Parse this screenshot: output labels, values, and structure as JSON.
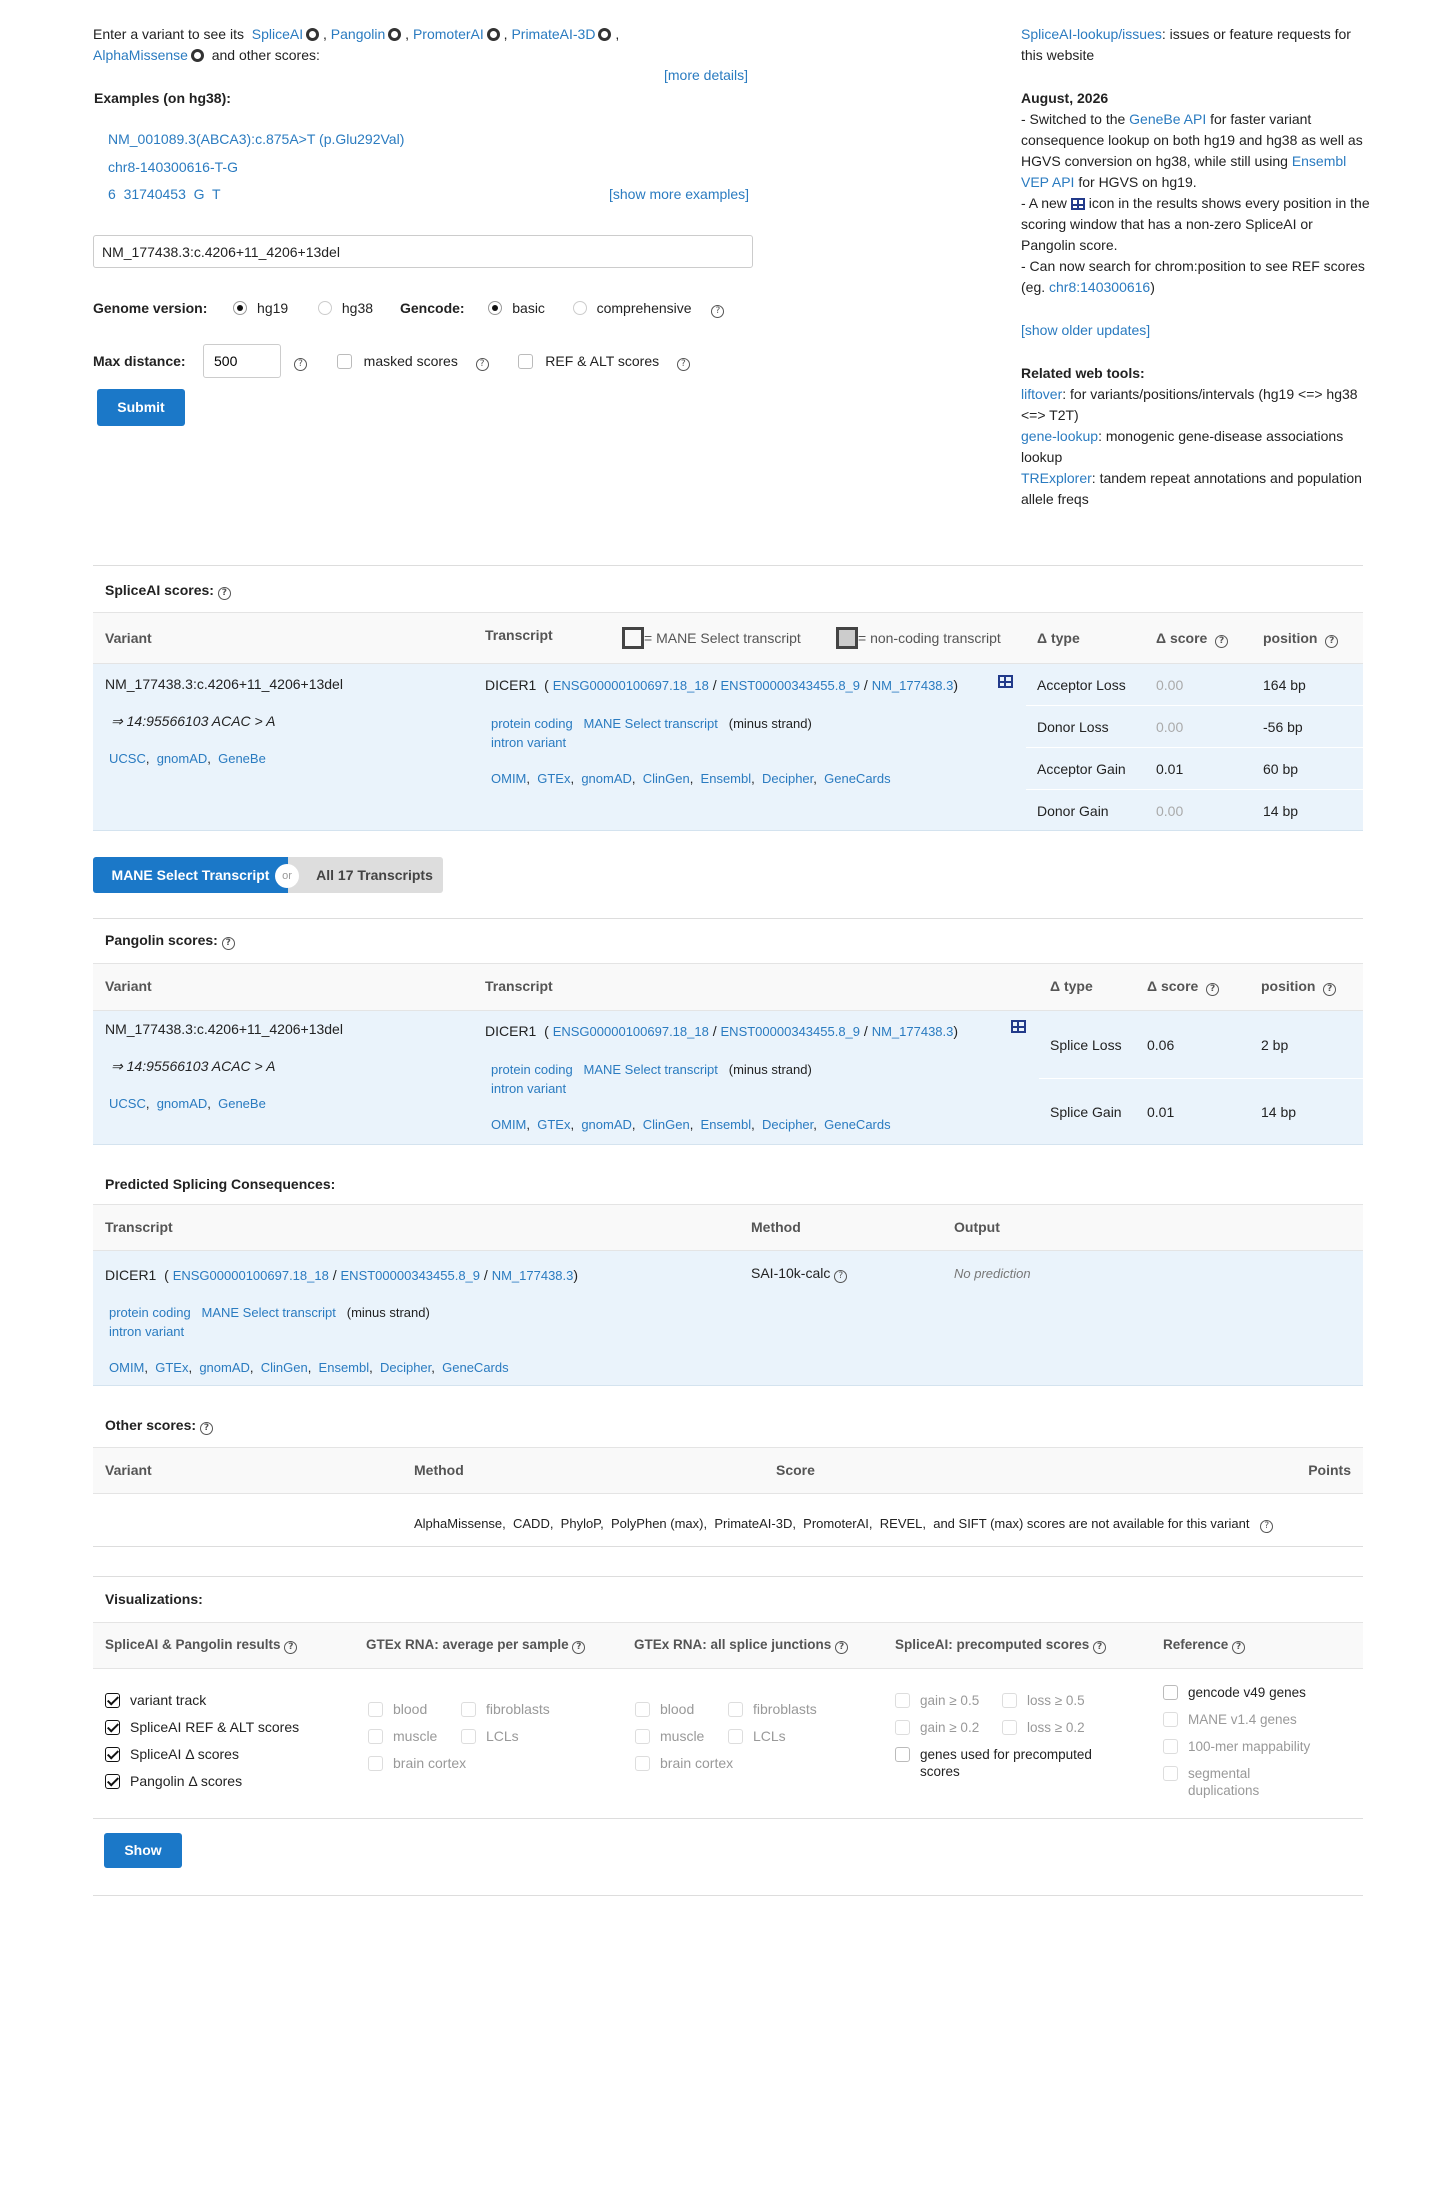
{
  "intro": {
    "prefix": "Enter a variant to see its",
    "tools": [
      "SpliceAI",
      "Pangolin",
      "PromoterAI",
      "PrimateAI-3D",
      "AlphaMissense"
    ],
    "suffix": "and other scores:",
    "more_details": "[more details]",
    "examples_label": "Examples  (on hg38):",
    "examples": [
      "NM_001089.3(ABCA3):c.875A>T (p.Glu292Val)",
      "chr8-140300616-T-G",
      "6  31740453  G  T"
    ],
    "show_more": "[show more examples]"
  },
  "form": {
    "variant_value": "NM_177438.3:c.4206+11_4206+13del",
    "genome_label": "Genome version:",
    "genome_options": [
      "hg19",
      "hg38"
    ],
    "gencode_label": "Gencode:",
    "gencode_options": [
      "basic",
      "comprehensive"
    ],
    "max_distance_label": "Max distance:",
    "max_distance_value": "500",
    "masked_label": "masked scores",
    "refalt_label": "REF & ALT scores",
    "submit": "Submit"
  },
  "sidebar": {
    "issues_link": "SpliceAI-lookup/issues",
    "issues_text": ": issues or feature requests for this website",
    "update_date": "August, 2026",
    "u1_a": "- Switched to the ",
    "u1_link1": "GeneBe API",
    "u1_b": " for faster variant consequence lookup on both hg19 and hg38 as well as HGVS conversion on hg38, while still using ",
    "u1_link2": "Ensembl VEP API",
    "u1_c": " for HGVS on hg19.",
    "u2_a": "- A new ",
    "u2_b": " icon in the results shows every position in the scoring window that has a non-zero SpliceAI or Pangolin score.",
    "u3_a": "- Can now search for chrom:position to see REF scores (eg. ",
    "u3_link": "chr8:140300616",
    "u3_b": ")",
    "older": "[show older updates]",
    "related_title": "Related web tools:",
    "liftover": "liftover",
    "liftover_text": ": for variants/positions/intervals (hg19 <=> hg38 <=> T2T)",
    "genelookup": "gene-lookup",
    "genelookup_text": ": monogenic gene-disease associations lookup",
    "trexplorer": "TRExplorer",
    "trexplorer_text": ": tandem repeat annotations and population allele freqs"
  },
  "spliceai": {
    "title": "SpliceAI scores:",
    "col_variant": "Variant",
    "col_transcript": "Transcript",
    "legend_mane": "= MANE Select transcript",
    "legend_noncoding": "= non-coding transcript",
    "col_type": "Δ type",
    "col_score": "Δ score",
    "col_position": "position",
    "variant": "NM_177438.3:c.4206+11_4206+13del",
    "variant_norm": "⇒ 14:95566103 ACAC > A",
    "variant_links": [
      "UCSC",
      "gnomAD",
      "GeneBe"
    ],
    "gene": "DICER1",
    "ids": [
      "ENSG00000100697.18_18",
      "ENST00000343455.8_9",
      "NM_177438.3"
    ],
    "tags": [
      "protein coding",
      "MANE Select transcript"
    ],
    "strand": "(minus strand)",
    "consequence": "intron variant",
    "db_links": [
      "OMIM",
      "GTEx",
      "gnomAD",
      "ClinGen",
      "Ensembl",
      "Decipher",
      "GeneCards"
    ],
    "rows": [
      {
        "type": "Acceptor Loss",
        "score": "0.00",
        "position": "164 bp"
      },
      {
        "type": "Donor Loss",
        "score": "0.00",
        "position": "-56 bp"
      },
      {
        "type": "Acceptor Gain",
        "score": "0.01",
        "position": "60 bp"
      },
      {
        "type": "Donor Gain",
        "score": "0.00",
        "position": "14 bp"
      }
    ]
  },
  "toggle": {
    "left": "MANE Select Transcript",
    "or": "or",
    "right": "All 17 Transcripts"
  },
  "pangolin": {
    "title": "Pangolin scores:",
    "rows": [
      {
        "type": "Splice Loss",
        "score": "0.06",
        "position": "2 bp"
      },
      {
        "type": "Splice Gain",
        "score": "0.01",
        "position": "14 bp"
      }
    ]
  },
  "consequences": {
    "title": "Predicted Splicing Consequences:",
    "col_transcript": "Transcript",
    "col_method": "Method",
    "col_output": "Output",
    "method": "SAI-10k-calc",
    "output": "No prediction"
  },
  "other": {
    "title": "Other scores:",
    "col_variant": "Variant",
    "col_method": "Method",
    "col_score": "Score",
    "col_points": "Points",
    "message": "AlphaMissense,  CADD,  PhyloP,  PolyPhen (max),  PrimateAI-3D,  PromoterAI,  REVEL,  and SIFT (max) scores are not available for this variant"
  },
  "viz": {
    "title": "Visualizations:",
    "col1": "SpliceAI & Pangolin results",
    "col2": "GTEx RNA: average per sample",
    "col3": "GTEx RNA: all splice junctions",
    "col4": "SpliceAI: precomputed scores",
    "col5": "Reference",
    "c1": [
      "variant track",
      "SpliceAI REF & ALT scores",
      "SpliceAI Δ  scores",
      "Pangolin Δ  scores"
    ],
    "tissues": [
      "blood",
      "fibroblasts",
      "muscle",
      "LCLs",
      "brain cortex"
    ],
    "pre": [
      "gain ≥ 0.5",
      "loss ≥ 0.5",
      "gain ≥ 0.2",
      "loss ≥ 0.2",
      "genes used for precomputed scores"
    ],
    "ref": [
      "gencode v49 genes",
      "MANE v1.4 genes",
      "100-mer mappability",
      "segmental duplications"
    ],
    "show": "Show"
  }
}
